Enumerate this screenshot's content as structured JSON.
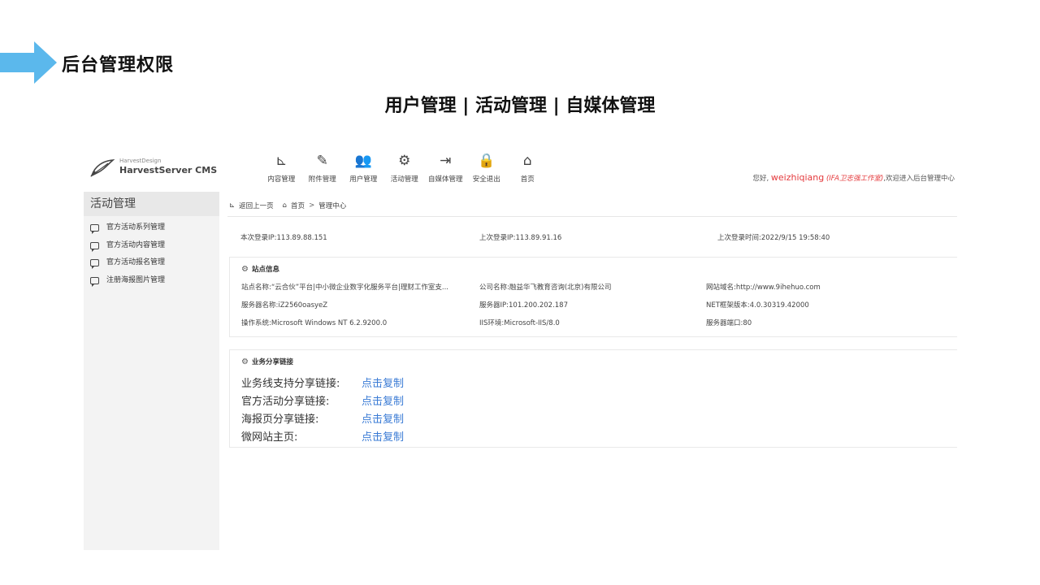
{
  "slide": {
    "title": "后台管理权限",
    "subtitle": "用户管理 | 活动管理 | 自媒体管理",
    "accent_color": "#5bb8ec"
  },
  "cms": {
    "logo": {
      "small": "HarvestDesign",
      "big": "HarvestServer CMS"
    },
    "nav": [
      {
        "label": "内容管理",
        "icon": "sitemap-icon",
        "glyph": "⊾"
      },
      {
        "label": "附件管理",
        "icon": "edit-icon",
        "glyph": "✎"
      },
      {
        "label": "用户管理",
        "icon": "users-icon",
        "glyph": "👥"
      },
      {
        "label": "活动管理",
        "icon": "gears-icon",
        "glyph": "⚙"
      },
      {
        "label": "自媒体管理",
        "icon": "sign-out-icon",
        "glyph": "⇥"
      },
      {
        "label": "安全退出",
        "icon": "lock-icon",
        "glyph": "🔒"
      },
      {
        "label": "首页",
        "icon": "home-icon",
        "glyph": "⌂"
      }
    ],
    "greeting": {
      "prefix": "您好,",
      "user": "weizhiqiang",
      "org": "(IFA卫志强工作室)",
      "suffix": ",欢迎进入后台管理中心"
    },
    "sidebar": {
      "title": "活动管理",
      "items": [
        "官方活动系列管理",
        "官方活动内容管理",
        "官方活动报名管理",
        "注册海报图片管理"
      ]
    },
    "breadcrumb": {
      "back": "返回上一页",
      "home": "首页",
      "sep": ">",
      "current": "管理中心"
    },
    "login": {
      "this_ip": "本次登录IP:113.89.88.151",
      "last_ip": "上次登录IP:113.89.91.16",
      "last_time": "上次登录时间:2022/9/15 19:58:40"
    },
    "site_info": {
      "title": "站点信息",
      "rows": [
        [
          "站点名称:“云合伙”平台|中小微企业数字化服务平台|理财工作室支...",
          "公司名称:融益华飞教育咨询(北京)有限公司",
          "网站域名:http://www.9ihehuo.com"
        ],
        [
          "服务器名称:iZ2560oasyeZ",
          "服务器IP:101.200.202.187",
          "NET框架版本:4.0.30319.42000"
        ],
        [
          "操作系统:Microsoft Windows NT 6.2.9200.0",
          "IIS环境:Microsoft-IIS/8.0",
          "服务器端口:80"
        ]
      ]
    },
    "share": {
      "title": "业务分享链接",
      "copy_label": "点击复制",
      "rows": [
        "业务线支持分享链接:",
        "官方活动分享链接:",
        "海报页分享链接:",
        "微网站主页:"
      ]
    }
  }
}
